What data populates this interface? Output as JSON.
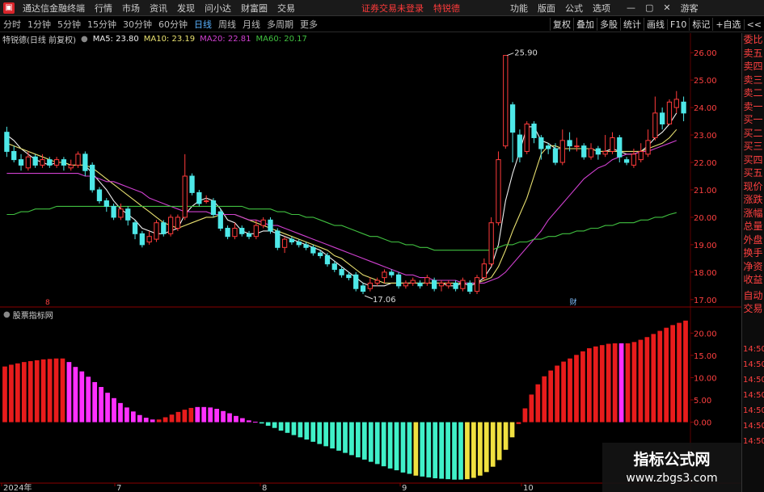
{
  "menubar": {
    "app_title": "通达信金融终端",
    "items": [
      "行情",
      "市场",
      "资讯",
      "发现",
      "问小达",
      "财富圈",
      "交易"
    ],
    "notice": "证券交易未登录",
    "stock_short": "特锐德",
    "right_items": [
      "功能",
      "版面",
      "公式",
      "选项"
    ],
    "guest": "游客",
    "min_icon": "minimize-icon",
    "max_icon": "maximize-icon",
    "close_icon": "close-icon"
  },
  "toolbar": {
    "periods": [
      "分时",
      "1分钟",
      "5分钟",
      "15分钟",
      "30分钟",
      "60分钟",
      "日线",
      "周线",
      "月线",
      "多周期",
      "更多"
    ],
    "active_period": "日线",
    "right_buttons": [
      "复权",
      "叠加",
      "多股",
      "统计",
      "画线",
      "F10",
      "标记",
      "+自选",
      "<<"
    ]
  },
  "indicator_line": {
    "stock_name": "特锐德(日线 前复权)",
    "ma5": "MA5: 23.80",
    "ma10": "MA10: 23.19",
    "ma20": "MA20: 22.81",
    "ma60": "MA60: 20.17"
  },
  "colors": {
    "up": "#ff3b3b",
    "down": "#4ee8e8",
    "ma5": "#f0f0f0",
    "ma10": "#e8e070",
    "ma20": "#d040d0",
    "ma60": "#40c040",
    "bar_red": "#e81c1c",
    "bar_magenta": "#ff30ff",
    "bar_cyan": "#40f0c8",
    "bar_yellow": "#f0e040"
  },
  "chart_data": [
    {
      "type": "candlestick",
      "title": "特锐德(日线 前复权)",
      "y_axis_labels": [
        "26.00",
        "25.00",
        "24.00",
        "23.00",
        "22.00",
        "21.00",
        "20.00",
        "19.00",
        "18.00",
        "17.00"
      ],
      "ylim": [
        16.7,
        26.3
      ],
      "annotations": [
        "25.90",
        "17.06"
      ],
      "x_labels": [
        "2024年",
        "7",
        "8",
        "9",
        "10"
      ],
      "event_markers": [
        "8",
        "财"
      ],
      "candles": [
        [
          23.1,
          22.4,
          23.3,
          22.2
        ],
        [
          22.4,
          22.1,
          22.6,
          22.0
        ],
        [
          22.1,
          21.9,
          22.3,
          21.7
        ],
        [
          21.8,
          22.2,
          22.4,
          21.7
        ],
        [
          22.2,
          21.9,
          22.3,
          21.8
        ],
        [
          21.9,
          22.1,
          22.3,
          21.8
        ],
        [
          22.1,
          21.9,
          22.2,
          21.8
        ],
        [
          21.9,
          22.1,
          22.2,
          21.8
        ],
        [
          22.1,
          21.9,
          22.2,
          21.7
        ],
        [
          21.8,
          21.9,
          22.1,
          21.7
        ],
        [
          21.9,
          22.3,
          22.4,
          21.8
        ],
        [
          22.3,
          21.7,
          22.4,
          21.5
        ],
        [
          21.9,
          21.0,
          22.0,
          20.9
        ],
        [
          21.0,
          20.6,
          21.1,
          20.5
        ],
        [
          20.6,
          20.4,
          20.7,
          20.2
        ],
        [
          20.4,
          20.0,
          20.5,
          19.9
        ],
        [
          20.0,
          20.3,
          20.5,
          19.9
        ],
        [
          20.3,
          19.9,
          20.4,
          19.7
        ],
        [
          19.8,
          19.4,
          19.9,
          19.2
        ],
        [
          19.4,
          19.0,
          19.5,
          18.9
        ],
        [
          19.1,
          19.3,
          19.5,
          19.0
        ],
        [
          19.2,
          19.8,
          19.9,
          19.1
        ],
        [
          19.8,
          19.4,
          19.9,
          19.3
        ],
        [
          19.4,
          20.0,
          20.1,
          19.3
        ],
        [
          19.6,
          20.0,
          20.1,
          19.5
        ],
        [
          20.0,
          21.5,
          22.3,
          19.9
        ],
        [
          21.5,
          20.9,
          21.6,
          20.8
        ],
        [
          20.9,
          20.5,
          21.0,
          20.4
        ],
        [
          20.6,
          20.6,
          20.8,
          20.5
        ],
        [
          20.6,
          20.1,
          20.7,
          20.0
        ],
        [
          20.2,
          19.6,
          20.3,
          19.5
        ],
        [
          19.6,
          19.3,
          19.7,
          19.2
        ],
        [
          19.3,
          19.6,
          19.8,
          19.2
        ],
        [
          19.6,
          19.4,
          19.7,
          19.3
        ],
        [
          19.4,
          19.3,
          19.5,
          19.2
        ],
        [
          19.3,
          19.7,
          19.9,
          19.2
        ],
        [
          19.7,
          19.9,
          20.0,
          19.6
        ],
        [
          19.9,
          19.5,
          20.0,
          19.4
        ],
        [
          19.5,
          18.9,
          19.6,
          18.8
        ],
        [
          18.9,
          19.2,
          19.3,
          18.7
        ],
        [
          19.2,
          19.1,
          19.3,
          19.0
        ],
        [
          19.1,
          19.0,
          19.2,
          18.9
        ],
        [
          19.0,
          18.9,
          19.1,
          18.8
        ],
        [
          18.9,
          18.7,
          19.0,
          18.6
        ],
        [
          18.7,
          18.6,
          18.8,
          18.5
        ],
        [
          18.6,
          18.3,
          18.7,
          18.2
        ],
        [
          18.3,
          18.1,
          18.4,
          18.0
        ],
        [
          18.1,
          17.9,
          18.2,
          17.8
        ],
        [
          17.9,
          17.8,
          18.0,
          17.7
        ],
        [
          17.9,
          17.4,
          18.0,
          17.3
        ],
        [
          17.5,
          17.3,
          17.6,
          17.2
        ],
        [
          17.4,
          17.6,
          17.8,
          17.3
        ],
        [
          17.6,
          17.7,
          17.8,
          17.5
        ],
        [
          17.8,
          18.0,
          18.1,
          17.6
        ],
        [
          18.0,
          17.9,
          18.1,
          17.8
        ],
        [
          17.9,
          17.5,
          18.0,
          17.4
        ],
        [
          17.5,
          17.6,
          17.7,
          17.4
        ],
        [
          17.6,
          17.7,
          17.8,
          17.5
        ],
        [
          17.6,
          17.5,
          17.7,
          17.4
        ],
        [
          17.6,
          17.8,
          17.9,
          17.5
        ],
        [
          17.7,
          17.4,
          17.8,
          17.3
        ],
        [
          17.5,
          17.6,
          17.7,
          17.3
        ],
        [
          17.5,
          17.6,
          17.7,
          17.4
        ],
        [
          17.6,
          17.4,
          17.7,
          17.3
        ],
        [
          17.4,
          17.7,
          17.8,
          17.3
        ],
        [
          17.6,
          17.3,
          17.7,
          17.2
        ],
        [
          17.3,
          17.8,
          17.9,
          17.2
        ],
        [
          17.8,
          18.3,
          18.5,
          17.7
        ],
        [
          18.3,
          19.8,
          20.0,
          18.2
        ],
        [
          19.8,
          22.1,
          22.4,
          19.7
        ],
        [
          22.6,
          25.9,
          25.9,
          22.5
        ],
        [
          24.1,
          23.1,
          24.2,
          22.0
        ],
        [
          23.0,
          22.2,
          23.2,
          22.0
        ],
        [
          22.4,
          23.4,
          23.5,
          22.3
        ],
        [
          23.4,
          22.9,
          23.5,
          22.7
        ],
        [
          22.9,
          22.5,
          23.0,
          22.1
        ],
        [
          22.6,
          22.5,
          22.7,
          22.3
        ],
        [
          22.5,
          22.0,
          22.7,
          21.9
        ],
        [
          22.0,
          22.8,
          23.2,
          21.9
        ],
        [
          22.8,
          22.6,
          23.1,
          22.4
        ],
        [
          22.6,
          22.6,
          22.9,
          22.4
        ],
        [
          22.6,
          22.2,
          22.7,
          22.1
        ],
        [
          22.2,
          22.5,
          22.7,
          22.1
        ],
        [
          22.5,
          22.3,
          22.6,
          22.1
        ],
        [
          22.3,
          22.4,
          23.0,
          22.2
        ],
        [
          22.4,
          22.9,
          23.1,
          22.3
        ],
        [
          22.9,
          22.2,
          23.0,
          22.0
        ],
        [
          22.1,
          22.0,
          22.2,
          21.9
        ],
        [
          21.9,
          22.3,
          22.5,
          21.8
        ],
        [
          22.1,
          22.4,
          22.7,
          22.0
        ],
        [
          22.3,
          22.8,
          23.2,
          22.2
        ],
        [
          22.9,
          23.8,
          24.4,
          22.8
        ],
        [
          23.8,
          23.4,
          24.0,
          23.2
        ],
        [
          23.4,
          24.2,
          24.3,
          23.4
        ],
        [
          24.0,
          24.3,
          24.6,
          23.8
        ],
        [
          24.2,
          23.8,
          24.4,
          23.5
        ]
      ],
      "ma_series": {
        "MA5": [
          23.0,
          22.8,
          22.5,
          22.3,
          22.1,
          22.0,
          21.9,
          22.0,
          22.0,
          21.9,
          21.9,
          21.9,
          21.6,
          21.3,
          21.0,
          20.6,
          20.3,
          20.1,
          19.9,
          19.6,
          19.5,
          19.4,
          19.4,
          19.5,
          19.6,
          20.1,
          20.4,
          20.6,
          20.7,
          20.6,
          20.3,
          19.9,
          19.8,
          19.5,
          19.4,
          19.4,
          19.5,
          19.5,
          19.4,
          19.3,
          19.2,
          19.1,
          19.0,
          18.9,
          18.8,
          18.6,
          18.4,
          18.2,
          18.0,
          17.8,
          17.6,
          17.5,
          17.5,
          17.5,
          17.6,
          17.6,
          17.6,
          17.6,
          17.6,
          17.6,
          17.6,
          17.6,
          17.5,
          17.5,
          17.6,
          17.5,
          17.6,
          17.8,
          18.2,
          19.0,
          20.6,
          21.6,
          22.4,
          23.3,
          23.3,
          22.8,
          22.7,
          22.5,
          22.5,
          22.5,
          22.5,
          22.5,
          22.5,
          22.4,
          22.4,
          22.5,
          22.4,
          22.3,
          22.3,
          22.4,
          22.6,
          22.9,
          23.1,
          23.4,
          23.8
        ],
        "MA10": [
          22.7,
          22.6,
          22.5,
          22.4,
          22.3,
          22.2,
          22.1,
          22.0,
          22.0,
          21.9,
          21.9,
          21.9,
          21.8,
          21.6,
          21.4,
          21.2,
          21.0,
          20.8,
          20.6,
          20.4,
          20.2,
          20.0,
          19.8,
          19.7,
          19.6,
          19.7,
          19.8,
          19.9,
          20.0,
          20.0,
          20.1,
          20.1,
          20.1,
          20.0,
          19.9,
          19.8,
          19.7,
          19.6,
          19.5,
          19.4,
          19.3,
          19.2,
          19.1,
          19.0,
          18.9,
          18.8,
          18.6,
          18.5,
          18.3,
          18.1,
          17.9,
          17.8,
          17.7,
          17.6,
          17.6,
          17.6,
          17.6,
          17.6,
          17.6,
          17.6,
          17.6,
          17.6,
          17.6,
          17.6,
          17.6,
          17.6,
          17.6,
          17.7,
          17.8,
          18.2,
          18.8,
          19.5,
          20.1,
          20.7,
          21.5,
          22.3,
          22.6,
          22.6,
          22.5,
          22.5,
          22.5,
          22.5,
          22.5,
          22.4,
          22.4,
          22.4,
          22.4,
          22.4,
          22.4,
          22.4,
          22.5,
          22.6,
          22.7,
          22.9,
          23.2
        ],
        "MA20": [
          21.6,
          21.6,
          21.6,
          21.6,
          21.6,
          21.6,
          21.6,
          21.6,
          21.6,
          21.6,
          21.6,
          21.5,
          21.5,
          21.4,
          21.3,
          21.3,
          21.2,
          21.1,
          21.0,
          20.9,
          20.7,
          20.6,
          20.5,
          20.4,
          20.3,
          20.2,
          20.2,
          20.2,
          20.2,
          20.1,
          20.1,
          20.1,
          20.1,
          20.0,
          19.9,
          19.9,
          19.8,
          19.7,
          19.7,
          19.6,
          19.5,
          19.4,
          19.3,
          19.2,
          19.1,
          19.0,
          18.9,
          18.8,
          18.7,
          18.6,
          18.5,
          18.4,
          18.3,
          18.2,
          18.1,
          18.0,
          17.9,
          17.9,
          17.8,
          17.8,
          17.7,
          17.7,
          17.7,
          17.7,
          17.6,
          17.6,
          17.6,
          17.6,
          17.7,
          17.8,
          18.0,
          18.3,
          18.6,
          18.9,
          19.2,
          19.5,
          19.9,
          20.2,
          20.5,
          20.8,
          21.1,
          21.4,
          21.6,
          21.8,
          21.9,
          22.1,
          22.2,
          22.3,
          22.3,
          22.4,
          22.4,
          22.5,
          22.6,
          22.7,
          22.8
        ],
        "MA60": [
          20.1,
          20.1,
          20.2,
          20.2,
          20.3,
          20.3,
          20.3,
          20.4,
          20.4,
          20.4,
          20.4,
          20.4,
          20.4,
          20.4,
          20.4,
          20.4,
          20.4,
          20.4,
          20.4,
          20.4,
          20.4,
          20.4,
          20.4,
          20.4,
          20.4,
          20.4,
          20.4,
          20.4,
          20.4,
          20.4,
          20.4,
          20.4,
          20.4,
          20.4,
          20.3,
          20.3,
          20.3,
          20.3,
          20.2,
          20.2,
          20.1,
          20.1,
          20.0,
          20.0,
          19.9,
          19.8,
          19.7,
          19.7,
          19.6,
          19.5,
          19.4,
          19.3,
          19.3,
          19.2,
          19.1,
          19.1,
          19.0,
          19.0,
          18.9,
          18.9,
          18.8,
          18.8,
          18.8,
          18.8,
          18.8,
          18.8,
          18.8,
          18.8,
          18.8,
          18.9,
          19.0,
          19.0,
          19.1,
          19.1,
          19.2,
          19.2,
          19.3,
          19.3,
          19.4,
          19.4,
          19.5,
          19.5,
          19.6,
          19.6,
          19.7,
          19.7,
          19.8,
          19.8,
          19.8,
          19.9,
          19.9,
          20.0,
          20.0,
          20.1,
          20.17
        ]
      }
    },
    {
      "type": "bar",
      "title": "股票指标网",
      "y_axis_labels": [
        "20.00",
        "15.00",
        "10.00",
        "5.00",
        "0.00"
      ],
      "right_time_labels": [
        "14:50",
        "14:50",
        "14:50",
        "14:50",
        "14:50",
        "14:50",
        "14:50"
      ],
      "ylim": [
        -13.5,
        23.5
      ],
      "values": [
        12.5,
        12.9,
        13.2,
        13.5,
        13.7,
        13.9,
        14.1,
        14.2,
        14.3,
        14.3,
        13.5,
        12.4,
        11.4,
        10.2,
        9.0,
        7.9,
        6.6,
        5.4,
        4.3,
        3.3,
        2.4,
        1.6,
        1.0,
        0.6,
        0.6,
        1.1,
        1.7,
        2.3,
        2.8,
        3.2,
        3.4,
        3.4,
        3.3,
        3.0,
        2.5,
        2.0,
        1.4,
        0.9,
        0.4,
        0.1,
        -0.3,
        -0.8,
        -1.3,
        -1.9,
        -2.4,
        -2.9,
        -3.4,
        -3.9,
        -4.4,
        -4.9,
        -5.4,
        -5.9,
        -6.4,
        -6.9,
        -7.4,
        -7.9,
        -8.4,
        -8.9,
        -9.4,
        -9.9,
        -10.4,
        -10.8,
        -11.3,
        -11.6,
        -12.0,
        -12.2,
        -12.4,
        -12.6,
        -12.7,
        -12.8,
        -12.9,
        -12.9,
        -12.8,
        -12.5,
        -12.0,
        -11.2,
        -10.0,
        -8.5,
        -6.2,
        -3.4,
        -0.4,
        3.1,
        6.2,
        8.5,
        10.3,
        11.6,
        12.7,
        13.6,
        14.3,
        15.1,
        15.9,
        16.6,
        17.0,
        17.3,
        17.6,
        17.7,
        17.7,
        17.7,
        18.0,
        18.5,
        19.1,
        19.8,
        20.5,
        21.2,
        21.8,
        22.3,
        22.8
      ],
      "colors": [
        "r",
        "r",
        "r",
        "r",
        "r",
        "r",
        "r",
        "r",
        "r",
        "r",
        "m",
        "m",
        "m",
        "m",
        "m",
        "m",
        "m",
        "m",
        "m",
        "m",
        "m",
        "m",
        "m",
        "m",
        "r",
        "r",
        "r",
        "r",
        "r",
        "r",
        "m",
        "m",
        "m",
        "m",
        "m",
        "m",
        "m",
        "m",
        "m",
        "m",
        "c",
        "c",
        "c",
        "c",
        "c",
        "c",
        "c",
        "c",
        "c",
        "c",
        "c",
        "c",
        "c",
        "c",
        "c",
        "c",
        "c",
        "c",
        "c",
        "c",
        "c",
        "c",
        "c",
        "c",
        "y",
        "c",
        "c",
        "c",
        "c",
        "c",
        "c",
        "c",
        "y",
        "y",
        "y",
        "y",
        "y",
        "y",
        "y",
        "y",
        "r",
        "r",
        "r",
        "r",
        "r",
        "r",
        "r",
        "r",
        "r",
        "r",
        "r",
        "r",
        "r",
        "r",
        "r",
        "r",
        "m",
        "r",
        "r",
        "r",
        "r",
        "r",
        "r",
        "r",
        "r",
        "r"
      ]
    }
  ],
  "right_panel": [
    "委比",
    "卖五",
    "卖四",
    "卖三",
    "卖二",
    "卖一",
    "买一",
    "买二",
    "买三",
    "买四",
    "买五",
    "现价",
    "涨跌",
    "涨幅",
    "总量",
    "外盘",
    "换手",
    "净资",
    "收益",
    "自动",
    "交易"
  ],
  "watermark": {
    "title": "指标公式网",
    "url": "www.zbgs3.com"
  }
}
